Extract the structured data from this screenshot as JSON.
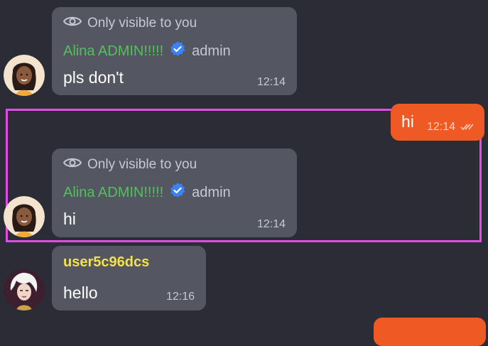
{
  "messages": [
    {
      "visibility_label": "Only visible to you",
      "sender": "Alina ADMIN!!!!!",
      "role": "admin",
      "text": "pls don't",
      "time": "12:14"
    },
    {
      "text": "hi",
      "time": "12:14"
    },
    {
      "visibility_label": "Only visible to you",
      "sender": "Alina ADMIN!!!!!",
      "role": "admin",
      "text": "hi",
      "time": "12:14"
    },
    {
      "sender": "user5c96dcs",
      "text": "hello",
      "time": "12:16"
    }
  ],
  "colors": {
    "background": "#2b2c36",
    "incoming_bubble": "#545762",
    "outgoing_bubble": "#ef5a24",
    "admin_name": "#52c15a",
    "user_name": "#f4e14a",
    "verified_badge": "#3b82f6",
    "highlight_frame": "#e04de4"
  }
}
